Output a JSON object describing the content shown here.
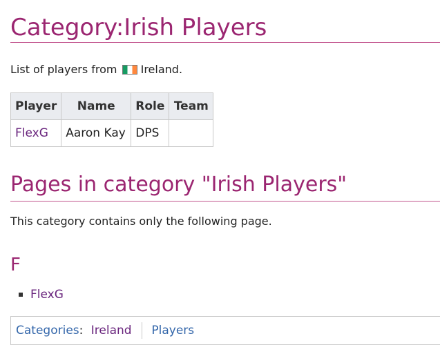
{
  "page": {
    "title": "Category:Irish Players",
    "intro_prefix": "List of players from",
    "intro_country": "Ireland."
  },
  "table": {
    "headers": [
      "Player",
      "Name",
      "Role",
      "Team"
    ],
    "rows": [
      {
        "player": "FlexG",
        "name": "Aaron Kay",
        "role": "DPS",
        "team": ""
      }
    ]
  },
  "pages_section": {
    "heading": "Pages in category \"Irish Players\"",
    "description": "This category contains only the following page.",
    "letter": "F",
    "items": [
      "FlexG"
    ]
  },
  "category_links": {
    "label": "Categories",
    "items": [
      "Ireland",
      "Players"
    ]
  },
  "colors": {
    "heading": "#9b2671",
    "link_visited": "#68237c",
    "link": "#3366aa",
    "rule": "#c1538d"
  },
  "icons": {
    "flag": "ireland-flag-icon",
    "bullet": "square-bullet-icon"
  }
}
